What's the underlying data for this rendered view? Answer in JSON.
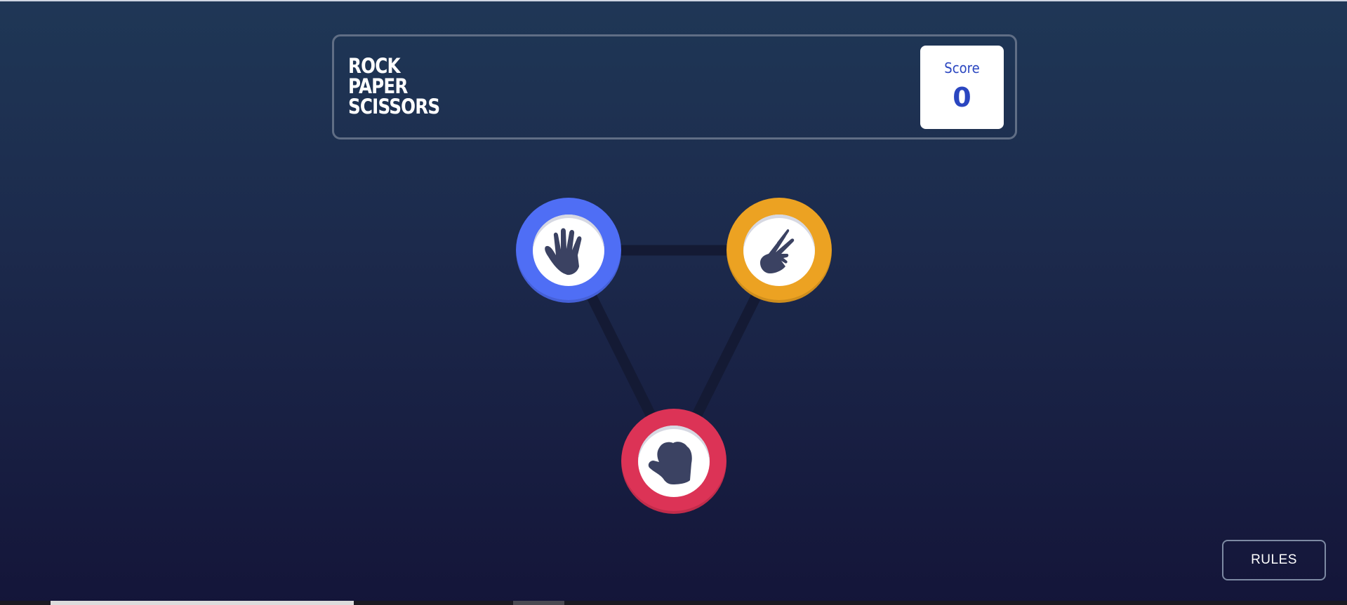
{
  "header": {
    "title_lines": [
      "ROCK",
      "PAPER",
      "SCISSORS"
    ],
    "score_label": "Score",
    "score_value": "0"
  },
  "choices": [
    {
      "id": "paper",
      "icon": "paper-hand-icon",
      "color": "#4f6ef5"
    },
    {
      "id": "scissors",
      "icon": "scissors-hand-icon",
      "color": "#eca222"
    },
    {
      "id": "rock",
      "icon": "rock-fist-icon",
      "color": "#dc3356"
    }
  ],
  "rules_button": {
    "label": "RULES"
  },
  "colors": {
    "background_top": "#1f3756",
    "background_bottom": "#141539",
    "score_text": "#2a46c0",
    "icon_fill": "#3b4262"
  }
}
